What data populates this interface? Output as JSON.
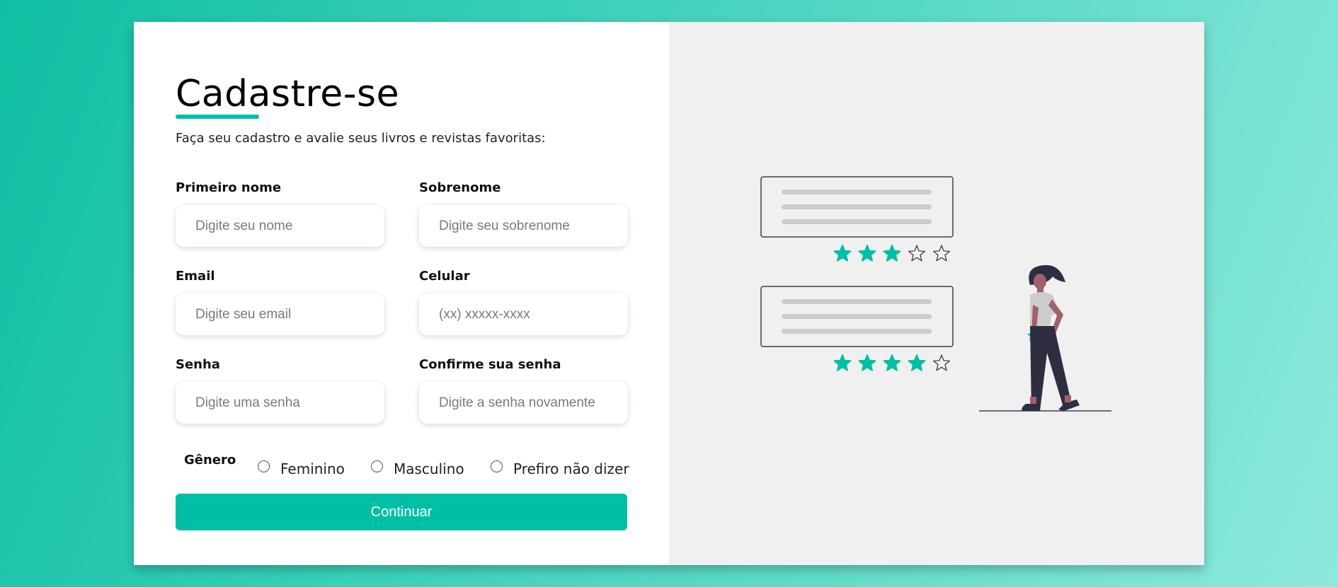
{
  "page": {
    "title": "Cadastre-se",
    "subtitle": "Faça seu cadastro e avalie seus livros e revistas favoritas:"
  },
  "form": {
    "first_name": {
      "label": "Primeiro nome",
      "placeholder": "Digite seu nome",
      "value": ""
    },
    "last_name": {
      "label": "Sobrenome",
      "placeholder": "Digite seu sobrenome",
      "value": ""
    },
    "email": {
      "label": "Email",
      "placeholder": "Digite seu email",
      "value": ""
    },
    "phone": {
      "label": "Celular",
      "placeholder": "(xx) xxxxx-xxxx",
      "value": ""
    },
    "password": {
      "label": "Senha",
      "placeholder": "Digite uma senha",
      "value": ""
    },
    "confirm_password": {
      "label": "Confirme sua senha",
      "placeholder": "Digite a senha novamente",
      "value": ""
    },
    "gender": {
      "label": "Gênero",
      "options": [
        "Feminino",
        "Masculino",
        "Prefiro não dizer"
      ],
      "selected": null
    },
    "submit_label": "Continuar"
  },
  "illustration": {
    "reviews": [
      {
        "rating": 3,
        "max": 5
      },
      {
        "rating": 4,
        "max": 5
      }
    ]
  },
  "colors": {
    "accent": "#00bfa6",
    "panel_bg": "#f0f0f0",
    "dark": "#2f2e41"
  }
}
